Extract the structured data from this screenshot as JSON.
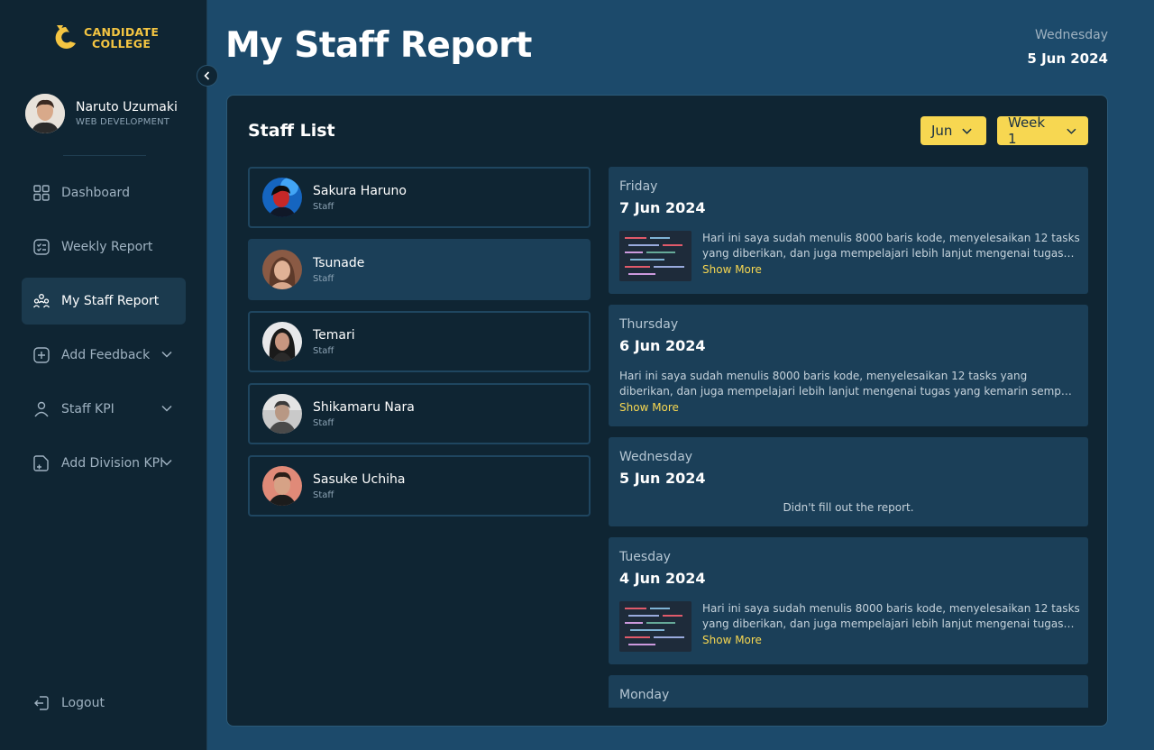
{
  "brand": {
    "line1": "CANDIDATE",
    "line2": "COLLEGE",
    "color": "#f4c542"
  },
  "profile": {
    "name": "Naruto Uzumaki",
    "role": "WEB DEVELOPMENT"
  },
  "nav": [
    {
      "label": "Dashboard",
      "icon": "grid-icon",
      "active": false,
      "expandable": false
    },
    {
      "label": "Weekly Report",
      "icon": "checklist-icon",
      "active": false,
      "expandable": false
    },
    {
      "label": "My Staff Report",
      "icon": "team-icon",
      "active": true,
      "expandable": false
    },
    {
      "label": "Add Feedback",
      "icon": "plus-square-icon",
      "active": false,
      "expandable": true
    },
    {
      "label": "Staff KPI",
      "icon": "user-icon",
      "active": false,
      "expandable": true
    },
    {
      "label": "Add Division KPI",
      "icon": "document-plus-icon",
      "active": false,
      "expandable": true
    }
  ],
  "logout_label": "Logout",
  "header": {
    "title": "My Staff Report",
    "day": "Wednesday",
    "date": "5 Jun 2024"
  },
  "panel": {
    "title": "Staff List",
    "month_filter": "Jun",
    "week_filter": "Week 1"
  },
  "staff": [
    {
      "name": "Sakura Haruno",
      "role": "Staff",
      "selected": false
    },
    {
      "name": "Tsunade",
      "role": "Staff",
      "selected": true
    },
    {
      "name": "Temari",
      "role": "Staff",
      "selected": false
    },
    {
      "name": "Shikamaru Nara",
      "role": "Staff",
      "selected": false
    },
    {
      "name": "Sasuke Uchiha",
      "role": "Staff",
      "selected": false
    }
  ],
  "reports": [
    {
      "day": "Friday",
      "date": "7 Jun 2024",
      "has_image": true,
      "text": "Hari ini saya sudah menulis 8000 baris kode, menyelesaikan 12 tasks yang diberikan, dan juga mempelajari lebih lanjut mengenai tugas yang kemarin sempat diberikan.",
      "show_more": "Show More"
    },
    {
      "day": "Thursday",
      "date": "6 Jun 2024",
      "has_image": false,
      "text": "Hari ini saya sudah menulis 8000 baris kode, menyelesaikan 12 tasks yang diberikan, dan juga mempelajari lebih lanjut mengenai tugas yang kemarin sempat diberikan. Selain itu saya juga membantu tim lain.",
      "show_more": "Show More"
    },
    {
      "day": "Wednesday",
      "date": "5 Jun 2024",
      "empty_text": "Didn't fill out the report."
    },
    {
      "day": "Tuesday",
      "date": "4 Jun 2024",
      "has_image": true,
      "text": "Hari ini saya sudah menulis 8000 baris kode, menyelesaikan 12 tasks yang diberikan, dan juga mempelajari lebih lanjut mengenai tugas yang kemarin sempat diberikan.",
      "show_more": "Show More"
    },
    {
      "day": "Monday"
    }
  ],
  "colors": {
    "accent": "#f7d751",
    "background": "#1c4a6b",
    "panel": "#0f2533",
    "card": "#1b3f58"
  }
}
